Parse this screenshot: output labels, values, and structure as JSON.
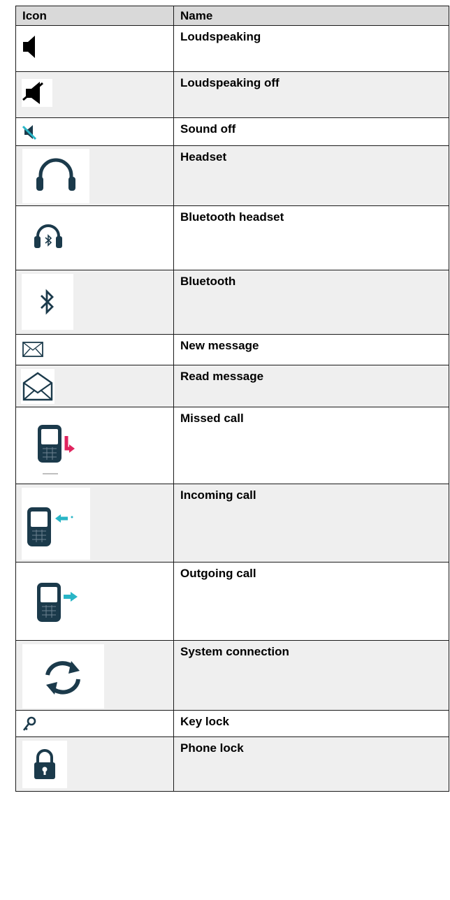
{
  "table": {
    "headers": {
      "icon": "Icon",
      "name": "Name"
    },
    "rows": [
      {
        "icon": "loudspeaker-icon",
        "name": "Loudspeaking"
      },
      {
        "icon": "loudspeaker-off-icon",
        "name": "Loudspeaking off"
      },
      {
        "icon": "sound-off-icon",
        "name": "Sound off"
      },
      {
        "icon": "headset-icon",
        "name": "Headset"
      },
      {
        "icon": "bluetooth-headset-icon",
        "name": "Bluetooth headset"
      },
      {
        "icon": "bluetooth-icon",
        "name": "Bluetooth"
      },
      {
        "icon": "new-message-icon",
        "name": "New message"
      },
      {
        "icon": "read-message-icon",
        "name": "Read message"
      },
      {
        "icon": "missed-call-icon",
        "name": "Missed call"
      },
      {
        "icon": "incoming-call-icon",
        "name": "Incoming call"
      },
      {
        "icon": "outgoing-call-icon",
        "name": "Outgoing call"
      },
      {
        "icon": "system-connection-icon",
        "name": "System connection"
      },
      {
        "icon": "key-lock-icon",
        "name": "Key lock"
      },
      {
        "icon": "phone-lock-icon",
        "name": "Phone lock"
      }
    ]
  },
  "colors": {
    "icon_dark": "#1b3a4b",
    "missed_arrow": "#e0245e",
    "call_arrow": "#29b5c6",
    "header_bg": "#d9d9d9",
    "alt_row_bg": "#efefef"
  }
}
